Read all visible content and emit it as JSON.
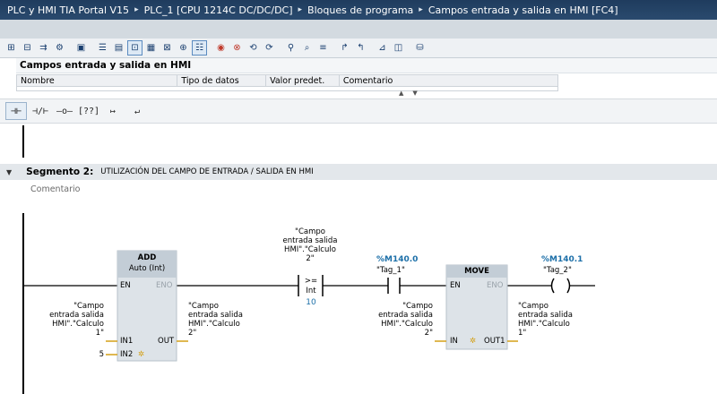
{
  "breadcrumb": [
    "PLC y HMI TIA Portal V15",
    "PLC_1 [CPU 1214C DC/DC/DC]",
    "Bloques de programa",
    "Campos entrada y salida en HMI [FC4]"
  ],
  "block_title": "Campos entrada y salida en HMI",
  "interface_columns": [
    "Nombre",
    "Tipo de datos",
    "Valor predet.",
    "Comentario"
  ],
  "toolbar_icons": [
    "network-insert-icon",
    "network-delete-icon",
    "branch-icon",
    "compile-icon",
    "monitor-icon",
    "list-icon",
    "table-icon",
    "zoom-icon",
    "properties-icon",
    "delete-icon",
    "go-online-icon",
    "go-offline-icon",
    "watch-icon",
    "download-icon",
    "upload-icon",
    "compare-icon",
    "settings-icon"
  ],
  "ladder_palette": {
    "items": [
      {
        "name": "no-contact-icon",
        "glyph": "⊣⊢"
      },
      {
        "name": "nc-contact-icon",
        "glyph": "⊣/⊢"
      },
      {
        "name": "coil-icon",
        "glyph": "–o–"
      },
      {
        "name": "empty-box-icon",
        "glyph": "[??]"
      },
      {
        "name": "open-branch-icon",
        "glyph": "↦"
      },
      {
        "name": "close-branch-icon",
        "glyph": "↵"
      }
    ]
  },
  "segment": {
    "number_label": "Segmento 2:",
    "title": "UTILIZACIÓN DEL CAMPO DE ENTRADA / SALIDA EN HMI",
    "comment_placeholder": "Comentario"
  },
  "network": {
    "add_block": {
      "name": "ADD",
      "type": "Auto (Int)",
      "en": "EN",
      "eno": "ENO",
      "in1": "IN1",
      "in2": "IN2",
      "out": "OUT",
      "in1_operand": [
        "\"Campo",
        "entrada salida",
        "HMI\".\"Calculo",
        "1\""
      ],
      "in2_operand": "5",
      "out_operand": [
        "\"Campo",
        "entrada salida",
        "HMI\".\"Calculo",
        "2\""
      ]
    },
    "compare": {
      "operand": [
        "\"Campo",
        "entrada salida",
        "HMI\".\"Calculo",
        "2\""
      ],
      "operator": ">=",
      "type": "Int",
      "value": "10"
    },
    "contact": {
      "address": "%M140.0",
      "tag": "\"Tag_1\""
    },
    "move_block": {
      "name": "MOVE",
      "en": "EN",
      "eno": "ENO",
      "in": "IN",
      "out1": "OUT1",
      "in_operand": [
        "\"Campo",
        "entrada salida",
        "HMI\".\"Calculo",
        "2\""
      ],
      "out1_operand": [
        "\"Campo",
        "entrada salida",
        "HMI\".\"Calculo",
        "1\""
      ]
    },
    "coil": {
      "address": "%M140.1",
      "tag": "\"Tag_2\""
    }
  },
  "colors": {
    "title_bar": "#1f3c5e",
    "block_header": "#c3cdd6",
    "block_body": "#dde3e8",
    "address": "#1c6fa8",
    "operand_line": "#d4a017"
  }
}
